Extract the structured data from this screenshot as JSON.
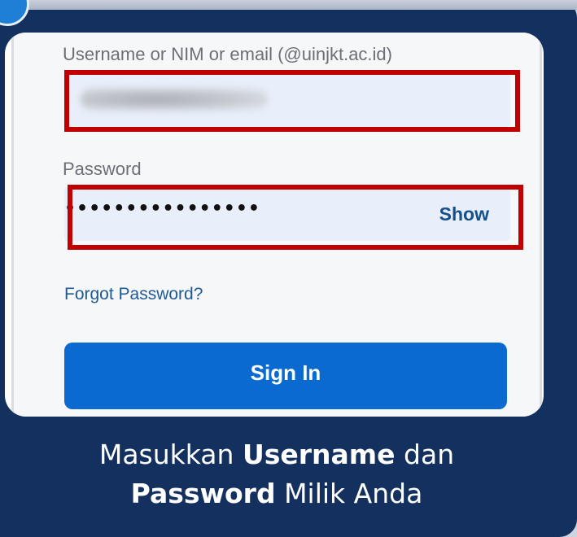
{
  "form": {
    "username_label": "Username or NIM or email (@uinjkt.ac.id)",
    "username_value": "",
    "password_label": "Password",
    "password_value": "••••••••••••••••",
    "show_label": "Show",
    "forgot_label": "Forgot Password?",
    "signin_label": "Sign In"
  },
  "caption": {
    "line1_pre": "Masukkan ",
    "line1_bold": "Username",
    "line1_post": " dan",
    "line2_bold": "Password",
    "line2_post": " Milik Anda"
  },
  "colors": {
    "panel": "#13305f",
    "highlight": "#c00000",
    "signin": "#0a6ad0",
    "field": "#e8effa"
  }
}
